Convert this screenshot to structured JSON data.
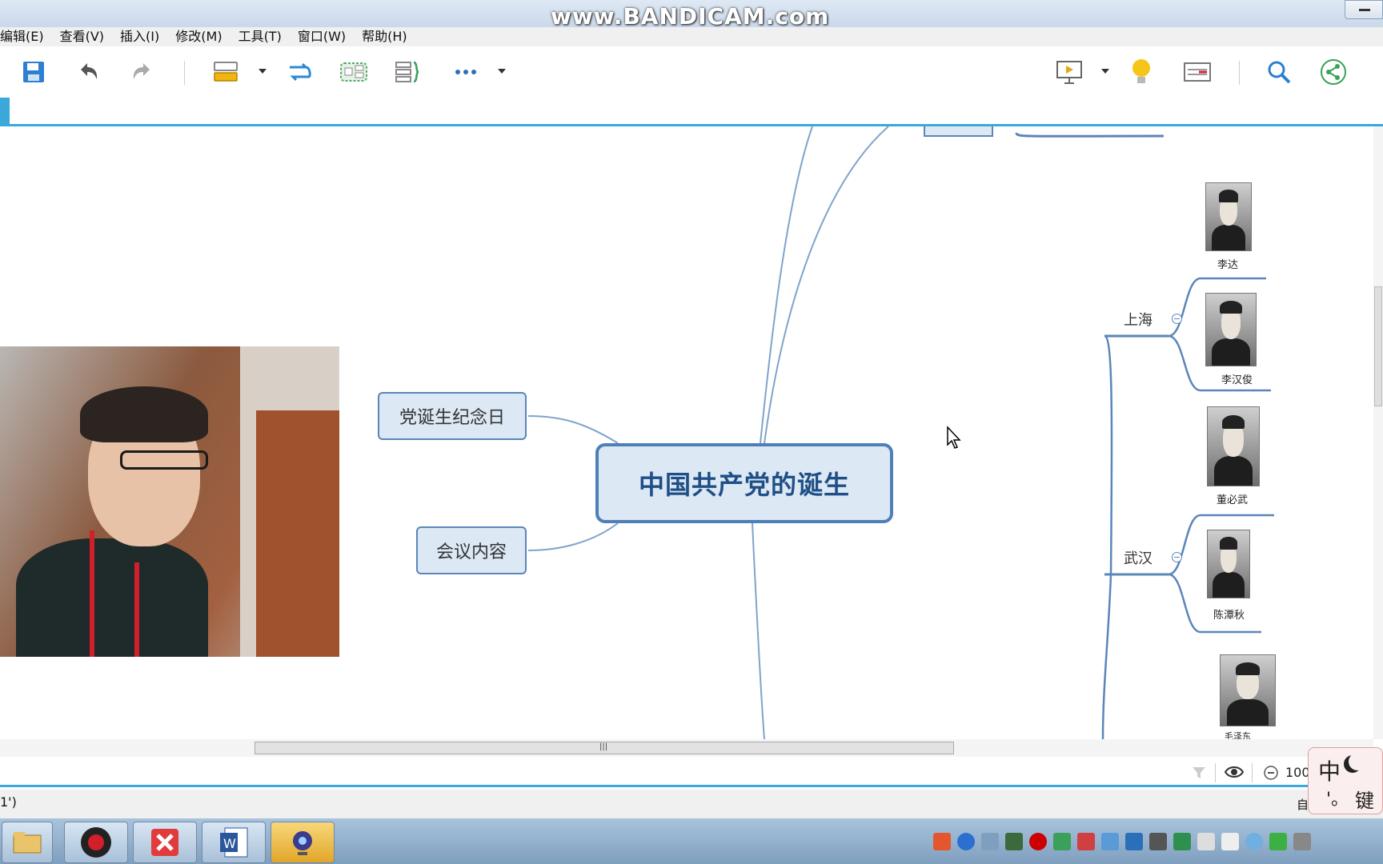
{
  "window": {
    "watermark": "www.BANDICAM.com"
  },
  "menu": {
    "items": [
      "编辑(E)",
      "查看(V)",
      "插入(I)",
      "修改(M)",
      "工具(T)",
      "窗口(W)",
      "帮助(H)"
    ]
  },
  "toolbar": {
    "icons": [
      "save-icon",
      "undo-icon",
      "redo-icon",
      "topic-icon",
      "relationship-icon",
      "boundary-icon",
      "summary-icon",
      "more-icon",
      "presentation-icon",
      "idea-icon",
      "outline-icon",
      "search-icon",
      "share-icon"
    ]
  },
  "mindmap": {
    "central_topic": "中国共产党的诞生",
    "left_topics": [
      "党诞生纪念日",
      "会议内容"
    ],
    "branches": [
      {
        "city": "上海",
        "people": [
          "李达",
          "李汉俊"
        ]
      },
      {
        "city": "武汉",
        "people": [
          "董必武",
          "陈潭秋"
        ]
      }
    ],
    "partial_person": "毛泽东"
  },
  "status": {
    "zoom": "100",
    "left_text": "1')",
    "right_text": "自"
  },
  "ime": {
    "char_main": "中",
    "char_sub": "键"
  }
}
